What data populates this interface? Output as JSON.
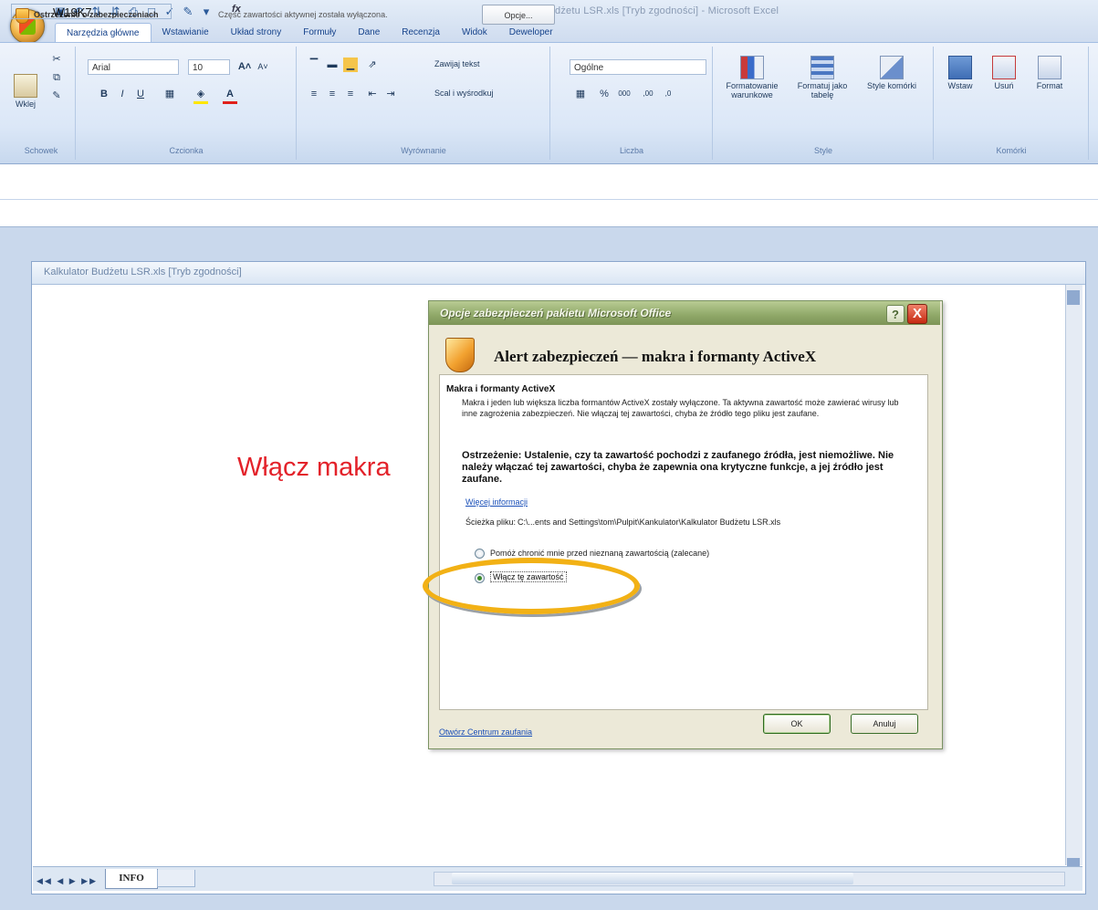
{
  "app": {
    "title": "Kalkulator Budżetu LSR.xls  [Tryb zgodności] - Microsoft Excel",
    "quick_access_icons": [
      "save-icon",
      "undo-icon",
      "sort-icon",
      "sort-desc-icon",
      "print-icon",
      "preview-icon",
      "spelling-icon",
      "paint-icon",
      "dropdown-icon"
    ]
  },
  "ribbon": {
    "tabs": [
      "Narzędzia główne",
      "Wstawianie",
      "Układ strony",
      "Formuły",
      "Dane",
      "Recenzja",
      "Widok",
      "Deweloper"
    ],
    "active_tab": 0,
    "groups": {
      "clipboard": {
        "label": "Schowek",
        "paste": "Wklej"
      },
      "font": {
        "label": "Czcionka",
        "font_name": "Arial",
        "font_size": "10"
      },
      "alignment": {
        "label": "Wyrównanie",
        "wrap_text": "Zawijaj tekst",
        "merge_center": "Scal i wyśrodkuj"
      },
      "number": {
        "label": "Liczba",
        "format": "Ogólne"
      },
      "styles": {
        "label": "Style",
        "conditional": "Formatowanie warunkowe",
        "format_table": "Formatuj jako tabelę",
        "cell_styles": "Style komórki"
      },
      "cells": {
        "label": "Komórki",
        "insert": "Wstaw",
        "delete": "Usuń",
        "format": "Format"
      }
    }
  },
  "security_bar": {
    "title": "Ostrzeżenie o zabezpieczeniach",
    "message": "Część zawartości aktywnej została wyłączona.",
    "options_button": "Opcje..."
  },
  "formula_bar": {
    "name_box": "W19K7",
    "fx": "fx"
  },
  "document": {
    "title": "Kalkulator Budżetu LSR.xls  [Tryb zgodności]",
    "cell_text": "Włącz makra",
    "sheet_tab": "INFO"
  },
  "dialog": {
    "title": "Opcje zabezpieczeń pakietu Microsoft Office",
    "help": "?",
    "close": "X",
    "heading": "Alert zabezpieczeń — makra i formanty ActiveX",
    "section_title": "Makra i formanty ActiveX",
    "description": "Makra i jeden lub większa liczba formantów ActiveX zostały wyłączone. Ta aktywna zawartość może zawierać wirusy lub inne zagrożenia zabezpieczeń. Nie włączaj tej zawartości, chyba że źródło tego pliku jest zaufane.",
    "warning": "Ostrzeżenie: Ustalenie, czy ta zawartość pochodzi z zaufanego źródła, jest niemożliwe. Nie należy włączać tej zawartości, chyba że zapewnia ona krytyczne funkcje, a jej źródło jest zaufane.",
    "more_info": "Więcej informacji",
    "path_label": "Ścieżka pliku:",
    "path_value": "C:\\...ents and Settings\\tom\\Pulpit\\Kankulator\\Kalkulator Budżetu LSR.xls",
    "option_protect": "Pomóż chronić mnie przed nieznaną zawartością (zalecane)",
    "option_enable": "Włącz tę zawartość",
    "selected_option": "option_enable",
    "trust_center_link": "Otwórz Centrum zaufania",
    "ok": "OK",
    "cancel": "Anuluj",
    "highlight_color": "#f2b115"
  }
}
